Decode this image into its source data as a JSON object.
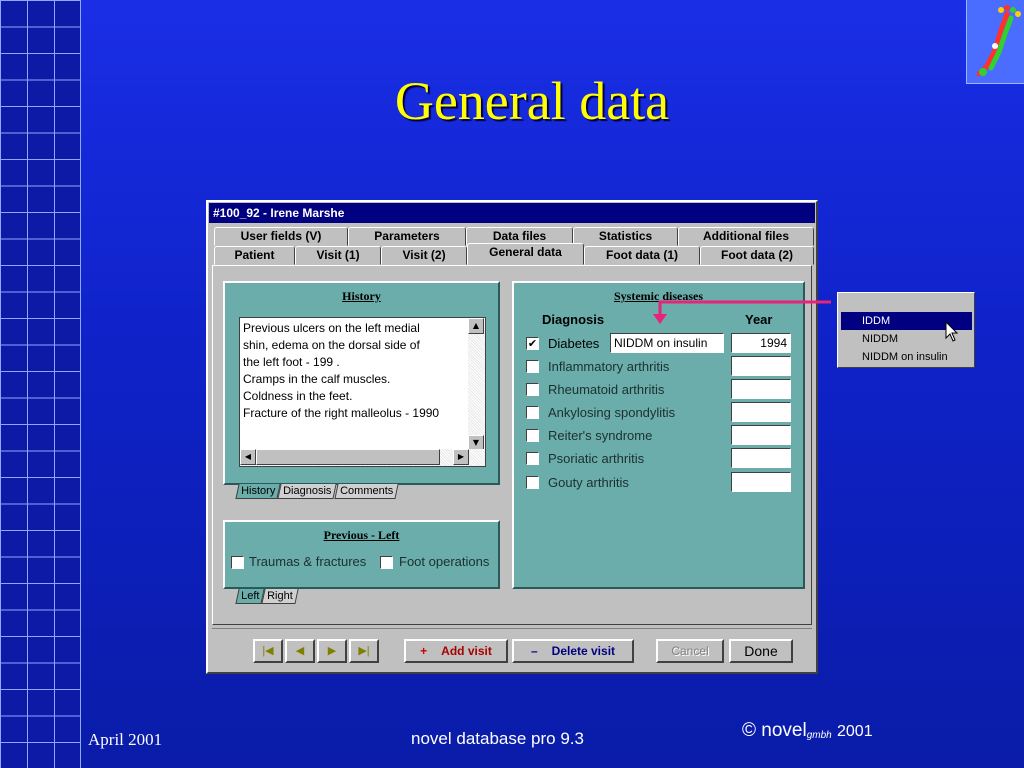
{
  "slide": {
    "title": "General data",
    "footer_date": "April 2001",
    "footer_center": "novel database pro 9.3",
    "footer_copyright": "©",
    "footer_brand": "novel",
    "footer_brand_sub": "gmbh",
    "footer_year": "2001"
  },
  "window": {
    "title": "#100_92 - Irene Marshe",
    "tabs_back": [
      "User fields (V)",
      "Parameters",
      "Data files",
      "Statistics",
      "Additional files"
    ],
    "tabs_front": [
      "Patient",
      "Visit (1)",
      "Visit (2)",
      "General data",
      "Foot data (1)",
      "Foot data (2)"
    ],
    "active_tab": "General data"
  },
  "history": {
    "title": "History",
    "lines": [
      "Previous ulcers on the left  medial",
      "shin, edema on the dorsal side of",
      "the left foot - 199 .",
      "Cramps in the calf muscles.",
      "Coldness in the feet.",
      "Fracture of the right malleolus - 1990"
    ],
    "subtabs": [
      "History",
      "Diagnosis",
      "Comments"
    ]
  },
  "previous": {
    "title": "Previous - Left",
    "traumas_label": "Traumas & fractures",
    "operations_label": "Foot operations",
    "subtabs": [
      "Left",
      "Right"
    ]
  },
  "systemic": {
    "title": "Systemic diseases",
    "diagnosis_header": "Diagnosis",
    "year_header": "Year",
    "diseases": [
      {
        "label": "Diabetes",
        "checked": true,
        "detail": "NIDDM on insulin",
        "year": "1994"
      },
      {
        "label": "Inflammatory arthritis",
        "checked": false,
        "year": ""
      },
      {
        "label": "Rheumatoid arthritis",
        "checked": false,
        "year": ""
      },
      {
        "label": "Ankylosing spondylitis",
        "checked": false,
        "year": ""
      },
      {
        "label": "Reiter's syndrome",
        "checked": false,
        "year": ""
      },
      {
        "label": "Psoriatic arthritis",
        "checked": false,
        "year": ""
      },
      {
        "label": "Gouty arthritis",
        "checked": false,
        "year": ""
      }
    ]
  },
  "buttons": {
    "first": "|◀",
    "prev": "◀",
    "next": "▶",
    "last": "▶|",
    "add_visit_sign": "+",
    "add_visit": "Add visit",
    "delete_visit_sign": "–",
    "delete_visit": "Delete visit",
    "cancel": "Cancel",
    "done": "Done"
  },
  "dropdown": {
    "options": [
      "IDDM",
      "NIDDM",
      "NIDDM on insulin"
    ],
    "selected": "IDDM"
  },
  "colors": {
    "panel": "#6aadaa",
    "title": "#ffff00",
    "selection": "#000080",
    "connector": "#e8237a"
  }
}
